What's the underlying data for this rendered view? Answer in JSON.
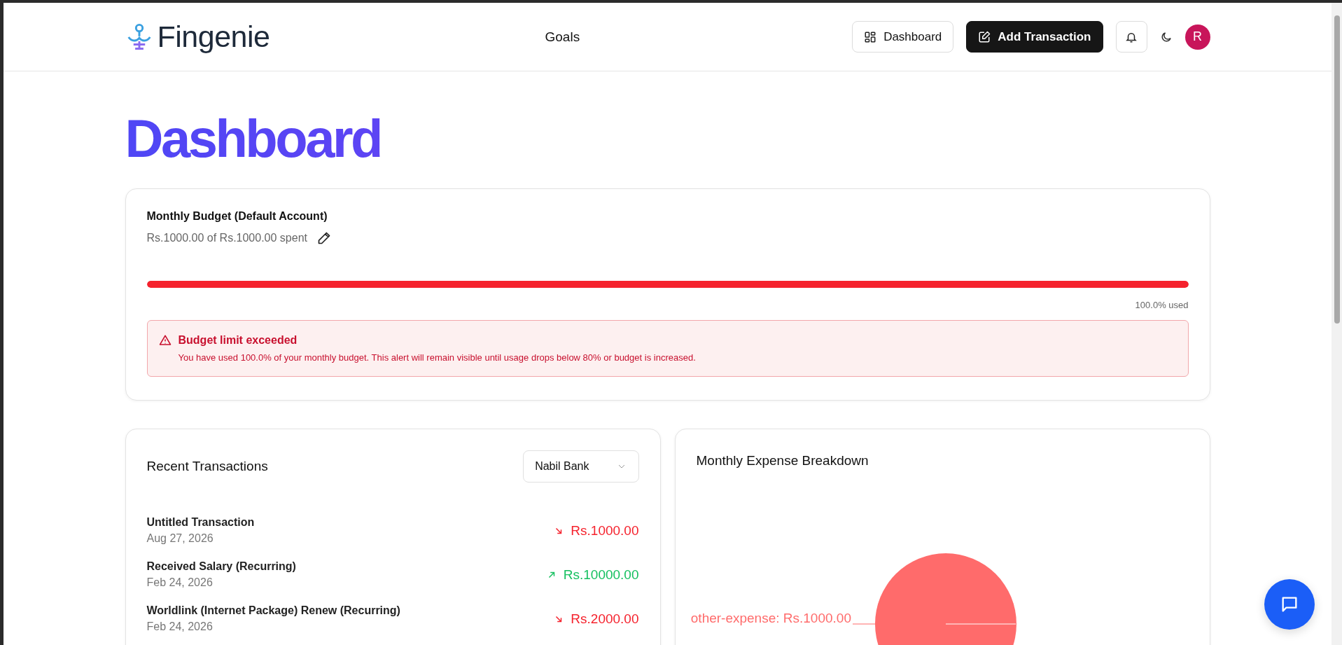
{
  "header": {
    "logo": "Fingenie",
    "nav": [
      {
        "label": "Goals"
      }
    ],
    "dashboard_button": "Dashboard",
    "add_button": "Add Transaction",
    "avatar": "R"
  },
  "page_title": "Dashboard",
  "budget": {
    "title": "Monthly Budget (Default Account)",
    "spent": "Rs.1000.00 of Rs.1000.00 spent",
    "level": 1.0,
    "used_label": "100.0% used",
    "alert": {
      "title": "Budget limit exceeded",
      "message": "You have used 100.0% of your monthly budget. This alert will remain visible until usage drops below 80% or budget is increased."
    }
  },
  "transactions": {
    "title": "Recent Transactions",
    "account_select": "Nabil Bank",
    "items": [
      {
        "title": "Untitled Transaction",
        "date": "Aug 27, 2026",
        "amount": "Rs.1000.00",
        "kind": "expense"
      },
      {
        "title": "Received Salary (Recurring)",
        "date": "Feb 24, 2026",
        "amount": "Rs.10000.00",
        "kind": "income"
      },
      {
        "title": "Worldlink (Internet Package) Renew (Recurring)",
        "date": "Feb 24, 2026",
        "amount": "Rs.2000.00",
        "kind": "expense"
      }
    ]
  },
  "expense_chart": {
    "title": "Monthly Expense Breakdown",
    "slice_label": "other-expense: Rs.1000.00"
  }
}
